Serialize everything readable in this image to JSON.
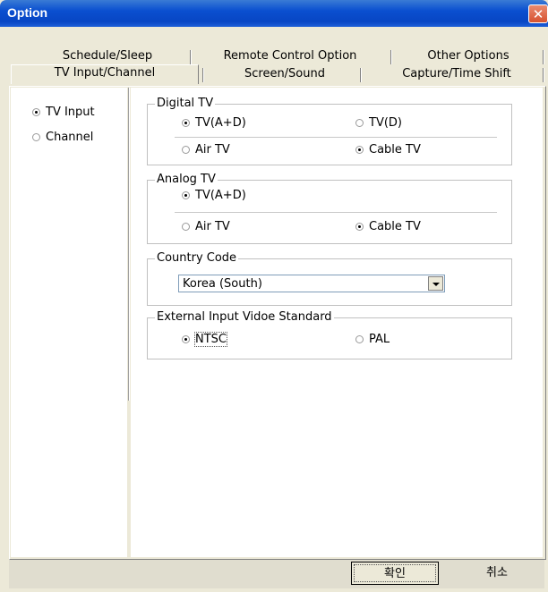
{
  "window": {
    "title": "Option",
    "close_glyph": "✕"
  },
  "tabs_row1": [
    "Schedule/Sleep",
    "Remote Control Option",
    "Other Options"
  ],
  "tabs_row2": [
    "TV Input/Channel",
    "Screen/Sound",
    "Capture/Time Shift"
  ],
  "active_tab": "TV Input/Channel",
  "left_options": {
    "tv_input": "TV Input",
    "channel": "Channel",
    "selected": "tv_input"
  },
  "digital_tv": {
    "legend": "Digital TV",
    "opt_tv_ad": "TV(A+D)",
    "opt_tv_d": "TV(D)",
    "selected_source": "tv_ad",
    "opt_air": "Air TV",
    "opt_cable": "Cable TV",
    "selected_type": "cable"
  },
  "analog_tv": {
    "legend": "Analog TV",
    "opt_tv_ad": "TV(A+D)",
    "selected_source": "tv_ad",
    "opt_air": "Air TV",
    "opt_cable": "Cable TV",
    "selected_type": "cable"
  },
  "country_code": {
    "legend": "Country Code",
    "value": "Korea (South)"
  },
  "video_standard": {
    "legend": "External Input Vidoe Standard",
    "opt_ntsc": "NTSC",
    "opt_pal": "PAL",
    "selected": "ntsc"
  },
  "buttons": {
    "ok": "확인",
    "cancel": "취소"
  },
  "icons": {
    "close": "close-icon",
    "radio": "radio-icon",
    "dropdown": "chevron-down-icon"
  }
}
